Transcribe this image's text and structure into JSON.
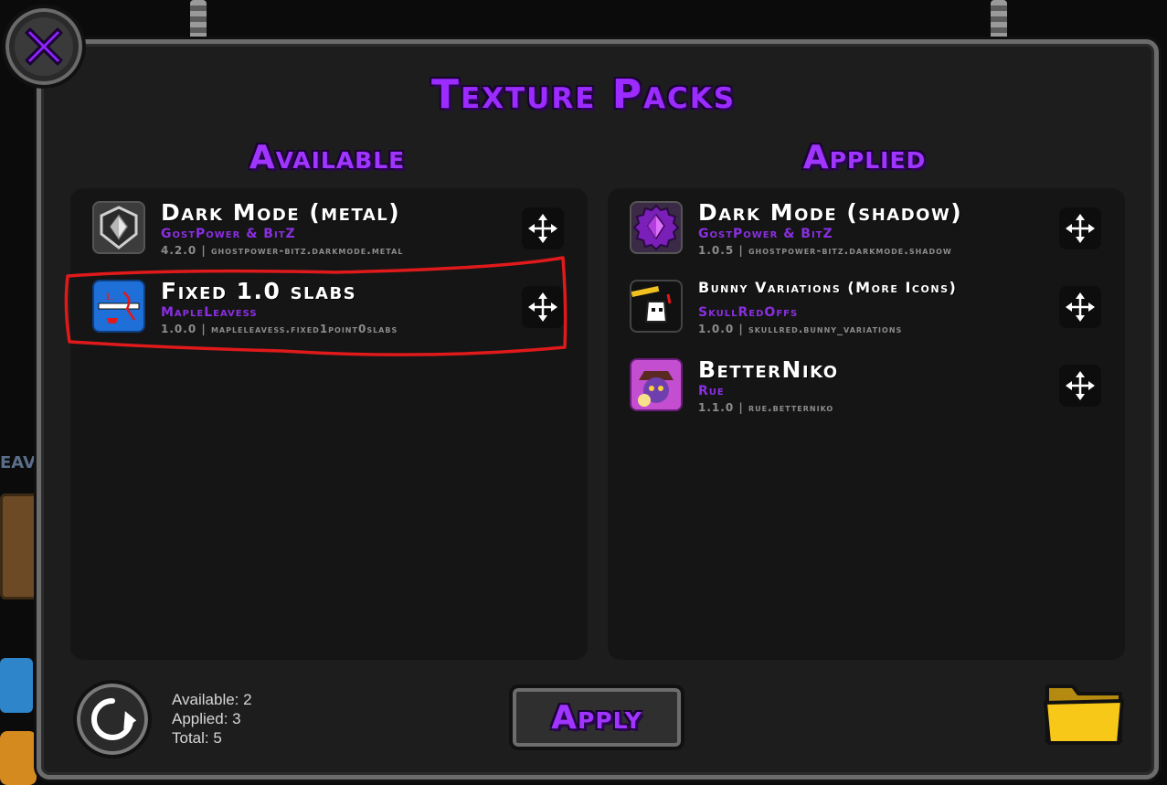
{
  "title": "Texture Packs",
  "columns": {
    "available": {
      "title": "Available",
      "items": [
        {
          "name": "Dark Mode (metal)",
          "author": "GostPower & BitZ",
          "version": "4.2.0",
          "id": "ghostpower-bitz.darkmode.metal",
          "icon": "metal-crystal-icon"
        },
        {
          "name": "Fixed 1.0 slabs",
          "author": "MapleLeavess",
          "version": "1.0.0",
          "id": "mapleleavess.fixed1point0slabs",
          "icon": "slabs-icon"
        }
      ]
    },
    "applied": {
      "title": "Applied",
      "items": [
        {
          "name": "Dark Mode (shadow)",
          "author": "GostPower & BitZ",
          "version": "1.0.5",
          "id": "ghostpower-bitz.darkmode.shadow",
          "icon": "shadow-crystal-icon"
        },
        {
          "name": "Bunny Variations (More Icons)",
          "author": "SkullRedOffs",
          "version": "1.0.0",
          "id": "skullred.bunny_variations",
          "icon": "bunny-icon"
        },
        {
          "name": "BetterNiko",
          "author": "Rue",
          "version": "1.1.0",
          "id": "rue.betterniko",
          "icon": "niko-icon"
        }
      ]
    }
  },
  "stats": {
    "available": "Available: 2",
    "applied": "Applied: 3",
    "total": "Total: 5"
  },
  "buttons": {
    "apply": "Apply",
    "close": "close-icon",
    "refresh": "refresh-icon",
    "folder": "folder-icon",
    "move": "move-arrows-icon"
  },
  "sep": "|",
  "colors": {
    "accent": "#a035ff",
    "author": "#8a2fe0",
    "annotation": "#e0191b"
  }
}
